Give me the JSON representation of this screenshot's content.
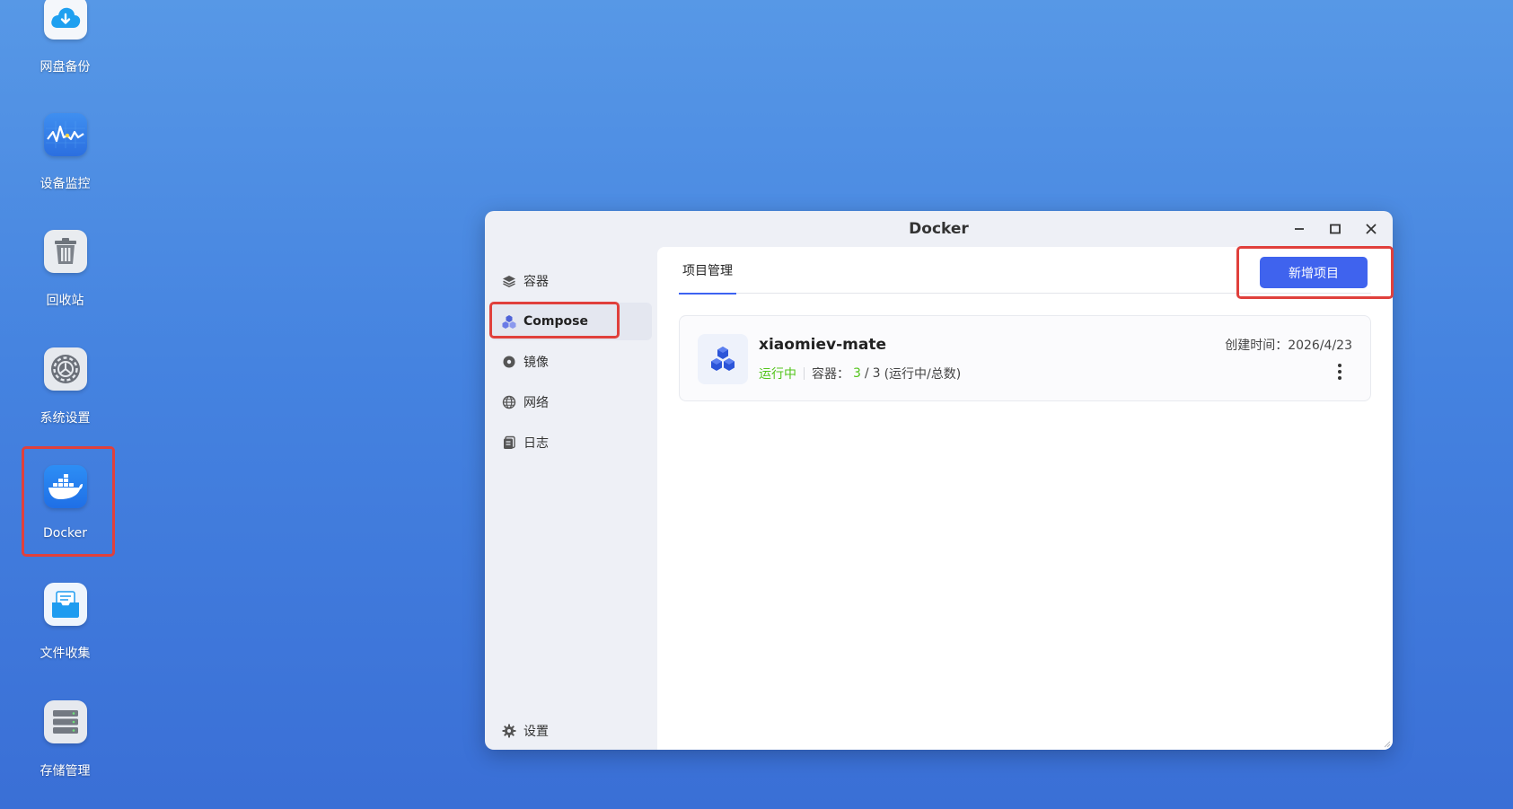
{
  "desktop": {
    "icons": [
      {
        "label": "网盘备份",
        "icon": "cloud-download-icon"
      },
      {
        "label": "设备监控",
        "icon": "monitor-chart-icon"
      },
      {
        "label": "回收站",
        "icon": "trash-icon"
      },
      {
        "label": "系统设置",
        "icon": "gear-icon"
      },
      {
        "label": "Docker",
        "icon": "docker-whale-icon"
      },
      {
        "label": "文件收集",
        "icon": "file-collect-icon"
      },
      {
        "label": "存储管理",
        "icon": "storage-icon"
      }
    ]
  },
  "window": {
    "title": "Docker",
    "controls": [
      "minimize-icon",
      "maximize-icon",
      "close-icon"
    ]
  },
  "sidebar": {
    "items": [
      {
        "label": "容器",
        "icon": "layers-icon",
        "active": false
      },
      {
        "label": "Compose",
        "icon": "compose-cubes-icon",
        "active": true
      },
      {
        "label": "镜像",
        "icon": "disc-icon",
        "active": false
      },
      {
        "label": "网络",
        "icon": "globe-icon",
        "active": false
      },
      {
        "label": "日志",
        "icon": "log-doc-icon",
        "active": false
      }
    ],
    "settings_label": "设置"
  },
  "main": {
    "tab_label": "项目管理",
    "add_button_label": "新增项目",
    "projects": [
      {
        "name": "xiaomiev-mate",
        "status": "运行中",
        "containers_label": "容器：",
        "running": "3",
        "separator": "/",
        "total": "3",
        "containers_note": "(运行中/总数)",
        "created": "创建时间：2026/4/23"
      }
    ]
  },
  "colors": {
    "accent": "#3f63ee",
    "running": "#52c41a",
    "highlight": "#e0403c"
  }
}
